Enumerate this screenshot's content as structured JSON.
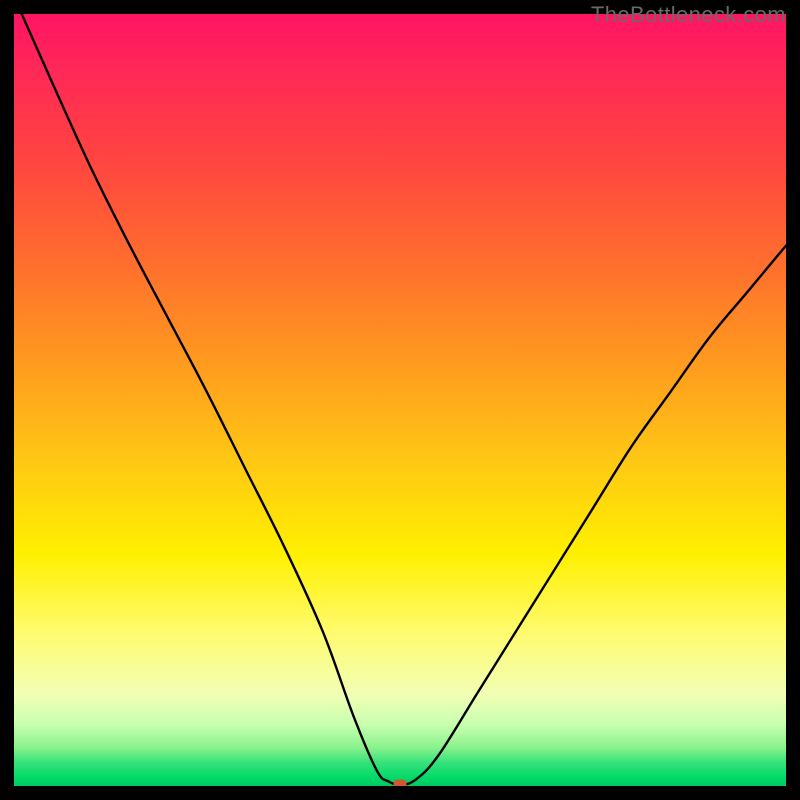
{
  "watermark": "TheBottleneck.com",
  "colors": {
    "background": "#000000",
    "curve_stroke": "#000000",
    "marker": "#d2572e",
    "gradient_top": "#ff1464",
    "gradient_mid": "#fff000",
    "gradient_bottom": "#00c85e"
  },
  "chart_data": {
    "type": "line",
    "title": "",
    "xlabel": "",
    "ylabel": "",
    "xlim": [
      0,
      100
    ],
    "ylim": [
      0,
      100
    ],
    "grid": false,
    "series": [
      {
        "name": "bottleneck-curve",
        "x": [
          1,
          5,
          10,
          15,
          20,
          25,
          30,
          35,
          40,
          44,
          47,
          48.5,
          50,
          52,
          55,
          60,
          65,
          70,
          75,
          80,
          85,
          90,
          95,
          100
        ],
        "y": [
          100,
          91,
          80,
          70,
          60.5,
          51,
          41,
          31,
          20,
          9,
          2,
          0.6,
          0.2,
          0.8,
          4,
          12,
          20,
          28,
          36,
          44,
          51,
          58,
          64,
          70
        ]
      }
    ],
    "marker": {
      "x": 50,
      "y": 0.2
    }
  }
}
